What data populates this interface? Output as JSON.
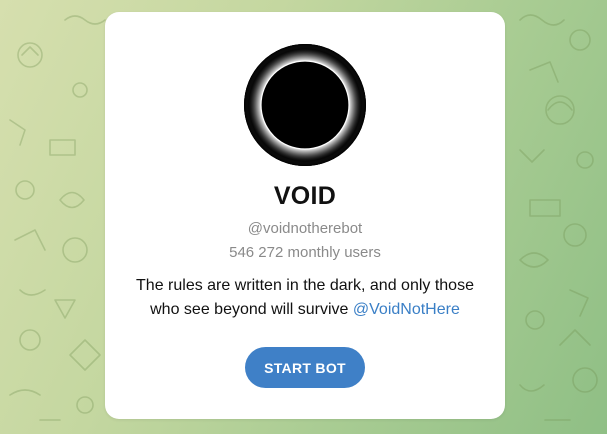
{
  "bot": {
    "name": "VOID",
    "username": "@voidnotherebot",
    "monthly_users": "546 272 monthly users",
    "description_text": "The rules are written in the dark, and only those who see beyond will survive ",
    "description_mention": "@VoidNotHere",
    "avatar_icon": "black-circle-ring-icon"
  },
  "actions": {
    "start_label": "START BOT"
  },
  "colors": {
    "background_start": "#d6dfae",
    "background_end": "#8fbf85",
    "card": "#ffffff",
    "accent": "#3f80c7",
    "link": "#3a7fc6",
    "muted_text": "#8a8a8a"
  }
}
